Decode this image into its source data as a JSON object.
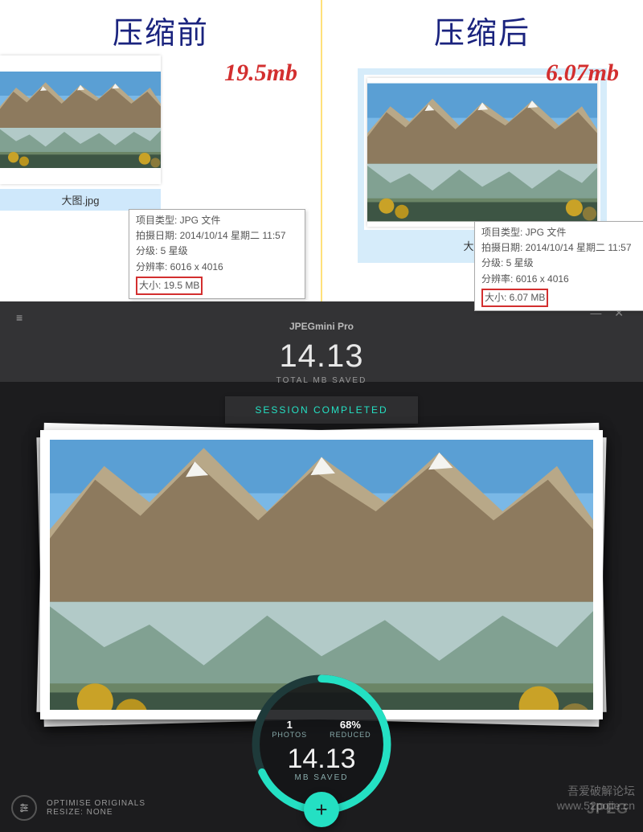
{
  "compare": {
    "before": {
      "title": "压缩前",
      "size_label": "19.5mb",
      "filename": "大图.jpg",
      "tooltip": {
        "type": "项目类型: JPG 文件",
        "date": "拍摄日期: 2014/10/14 星期二 11:57",
        "rating": "分级: 5 星级",
        "dim": "分辨率: 6016 x 4016",
        "size": "大小: 19.5 MB"
      }
    },
    "after": {
      "title": "压缩后",
      "size_label": "6.07mb",
      "filename": "大图.jpg",
      "tooltip": {
        "type": "项目类型: JPG 文件",
        "date": "拍摄日期: 2014/10/14 星期二 11:57",
        "rating": "分级: 5 星级",
        "dim": "分辨率: 6016 x 4016",
        "size": "大小: 6.07 MB"
      }
    }
  },
  "app": {
    "title": "JPEGmini Pro",
    "hero_value": "14.13",
    "hero_label": "TOTAL MB SAVED",
    "session": "SESSION COMPLETED",
    "gauge": {
      "photos_n": "1",
      "photos_l": "PHOTOS",
      "reduced_n": "68%",
      "reduced_l": "REDUCED",
      "main": "14.13",
      "main_l": "MB SAVED",
      "percent": 68
    },
    "footer": {
      "line1": "OPTIMISE ORIGINALS",
      "line2": "RESIZE: NONE"
    },
    "brand": "JPEG"
  },
  "watermark": {
    "l1": "吾爱破解论坛",
    "l2": "www.52pojie.cn"
  }
}
